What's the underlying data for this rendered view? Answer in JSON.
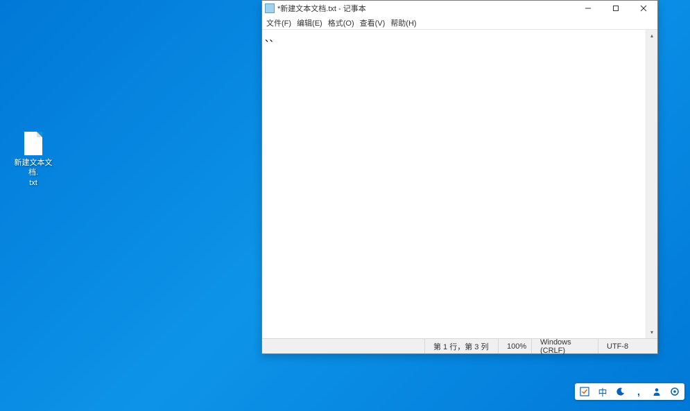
{
  "desktop": {
    "file_icon_label": "新建文本文档.\ntxt"
  },
  "notepad": {
    "title": "*新建文本文档.txt - 记事本",
    "menus": {
      "file": "文件(F)",
      "edit": "编辑(E)",
      "format": "格式(O)",
      "view": "查看(V)",
      "help": "帮助(H)"
    },
    "content": "、、",
    "status": {
      "position": "第 1 行，第 3 列",
      "zoom": "100%",
      "line_ending": "Windows (CRLF)",
      "encoding": "UTF-8"
    }
  },
  "systray": {
    "ime": "中"
  }
}
